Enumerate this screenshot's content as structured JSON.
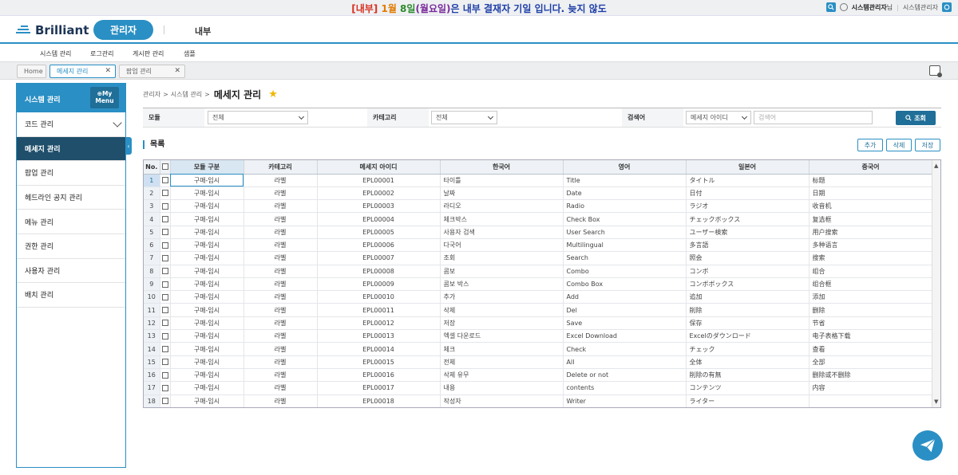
{
  "banner": {
    "part1": "[내부]",
    "part2": "1월",
    "part3": "8일",
    "part4": "(월요일)",
    "part5": "은 내부 결재자 기일 입니다. 늦지 않도",
    "colors": {
      "red": "#d7301f",
      "orange": "#e27b00",
      "green": "#2c8a2c",
      "purple": "#7a2a9c",
      "blue": "#1f3fa8"
    }
  },
  "top_right": {
    "user_name": "시스템관리자",
    "suffix": "님",
    "separator": "|",
    "role": "시스템관리자"
  },
  "header": {
    "logo": "Brilliant",
    "tab_admin": "관리자",
    "tab_internal": "내부"
  },
  "menu": [
    "시스템 관리",
    "로그관리",
    "게시판 관리",
    "샘플"
  ],
  "open_tabs": [
    {
      "label": "Home"
    },
    {
      "label": "메세지 관리"
    },
    {
      "label": "팝업 관리"
    }
  ],
  "sidebar": {
    "title": "시스템 관리",
    "my_menu_line1": "⊕My",
    "my_menu_line2": "Menu",
    "items": [
      "코드 관리",
      "메세지 관리",
      "팝업 관리",
      "헤드라인 공지 관리",
      "메뉴 관리",
      "권한 관리",
      "사용자 관리",
      "배치 관리"
    ],
    "active_index": 1
  },
  "breadcrumb": {
    "level1": "관리자",
    "sep": ">",
    "level2": "시스템 관리",
    "current": "메세지 관리"
  },
  "search": {
    "module_label": "모듈",
    "module_value": "전체",
    "category_label": "카테고리",
    "category_value": "전체",
    "keyword_label": "검색어",
    "keyword_type": "메세지 아이디",
    "keyword_placeholder": "검색어",
    "button": "조회"
  },
  "list": {
    "title": "목록",
    "add": "추가",
    "delete": "삭제",
    "save": "저장"
  },
  "grid": {
    "headers": [
      "No.",
      "",
      "모듈 구분",
      "카테고리",
      "메세지 아이디",
      "한국어",
      "영어",
      "일본어",
      "중국어"
    ],
    "rows": [
      [
        "1",
        "구매-임시",
        "라벨",
        "EPL00001",
        "타이틀",
        "Title",
        "タイトル",
        "标题"
      ],
      [
        "2",
        "구매-임시",
        "라벨",
        "EPL00002",
        "날짜",
        "Date",
        "日付",
        "日期"
      ],
      [
        "3",
        "구매-임시",
        "라벨",
        "EPL00003",
        "라디오",
        "Radio",
        "ラジオ",
        "收音机"
      ],
      [
        "4",
        "구매-임시",
        "라벨",
        "EPL00004",
        "체크박스",
        "Check Box",
        "チェックボックス",
        "复选框"
      ],
      [
        "5",
        "구매-임시",
        "라벨",
        "EPL00005",
        "사용자 검색",
        "User Search",
        "ユーザー検索",
        "用户搜索"
      ],
      [
        "6",
        "구매-임시",
        "라벨",
        "EPL00006",
        "다국어",
        "Multilingual",
        "多言語",
        "多种语言"
      ],
      [
        "7",
        "구매-임시",
        "라벨",
        "EPL00007",
        "조회",
        "Search",
        "照会",
        "搜索"
      ],
      [
        "8",
        "구매-임시",
        "라벨",
        "EPL00008",
        "콤보",
        "Combo",
        "コンボ",
        "组合"
      ],
      [
        "9",
        "구매-임시",
        "라벨",
        "EPL00009",
        "콤보 박스",
        "Combo Box",
        "コンボボックス",
        "组合框"
      ],
      [
        "10",
        "구매-임시",
        "라벨",
        "EPL00010",
        "추가",
        "Add",
        "追加",
        "添加"
      ],
      [
        "11",
        "구매-임시",
        "라벨",
        "EPL00011",
        "삭제",
        "Del",
        "削除",
        "删除"
      ],
      [
        "12",
        "구매-임시",
        "라벨",
        "EPL00012",
        "저장",
        "Save",
        "保存",
        "节省"
      ],
      [
        "13",
        "구매-임시",
        "라벨",
        "EPL00013",
        "엑셀 다운로드",
        "Excel Download",
        "Excelのダウンロード",
        "电子表格下载"
      ],
      [
        "14",
        "구매-임시",
        "라벨",
        "EPL00014",
        "체크",
        "Check",
        "チェック",
        "查看"
      ],
      [
        "15",
        "구매-임시",
        "라벨",
        "EPL00015",
        "전체",
        "All",
        "全体",
        "全部"
      ],
      [
        "16",
        "구매-임시",
        "라벨",
        "EPL00016",
        "삭제 유무",
        "Delete or not",
        "削除の有無",
        "删除或不删除"
      ],
      [
        "17",
        "구매-임시",
        "라벨",
        "EPL00017",
        "내용",
        "contents",
        "コンテンツ",
        "内容"
      ],
      [
        "18",
        "구매-임시",
        "라벨",
        "EPL00018",
        "작성자",
        "Writer",
        "ライター",
        ""
      ]
    ],
    "selected_row": 0
  },
  "icons": {
    "search_icon": "search-icon",
    "user_icon": "user-icon",
    "refresh_icon": "refresh-icon",
    "star_icon": "star-icon",
    "send_icon": "paper-plane-icon"
  },
  "accent_color": "#2a8fc4"
}
